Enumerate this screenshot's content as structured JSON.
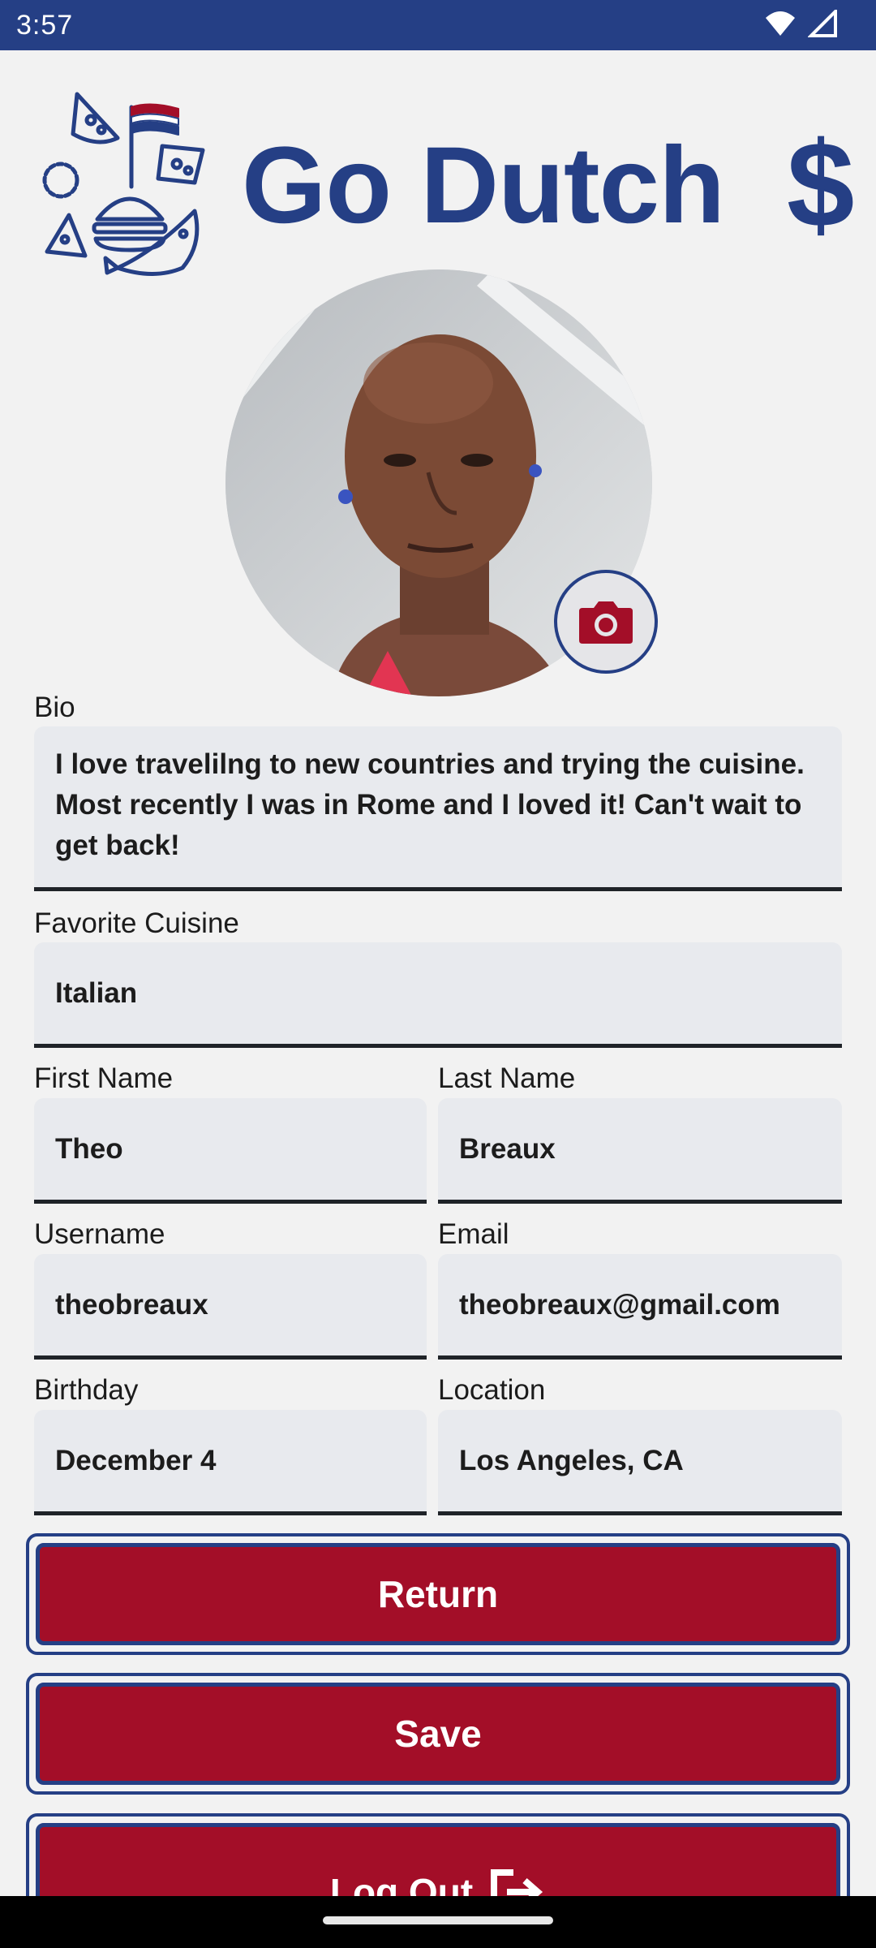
{
  "status": {
    "time": "3:57"
  },
  "header": {
    "title": "Go Dutch",
    "currency_symbol": "$"
  },
  "profile": {
    "bio_label": "Bio",
    "bio": "I love travelilng to new countries and trying the cuisine. Most recently I was in Rome and I loved it! Can't wait to get back!",
    "cuisine_label": "Favorite Cuisine",
    "cuisine": "Italian",
    "first_name_label": "First Name",
    "first_name": "Theo",
    "last_name_label": "Last Name",
    "last_name": "Breaux",
    "username_label": "Username",
    "username": "theobreaux",
    "email_label": "Email",
    "email": "theobreaux@gmail.com",
    "birthday_label": "Birthday",
    "birthday": "December 4",
    "location_label": "Location",
    "location": "Los Angeles, CA"
  },
  "actions": {
    "return_label": "Return",
    "save_label": "Save",
    "logout_label": "Log Out"
  },
  "colors": {
    "primary_blue": "#253f85",
    "button_red": "#a30e28",
    "field_bg": "#e8eaee"
  },
  "icons": [
    "wifi-icon",
    "cellular-signal-icon",
    "food-logo-icon",
    "camera-icon",
    "logout-icon"
  ]
}
